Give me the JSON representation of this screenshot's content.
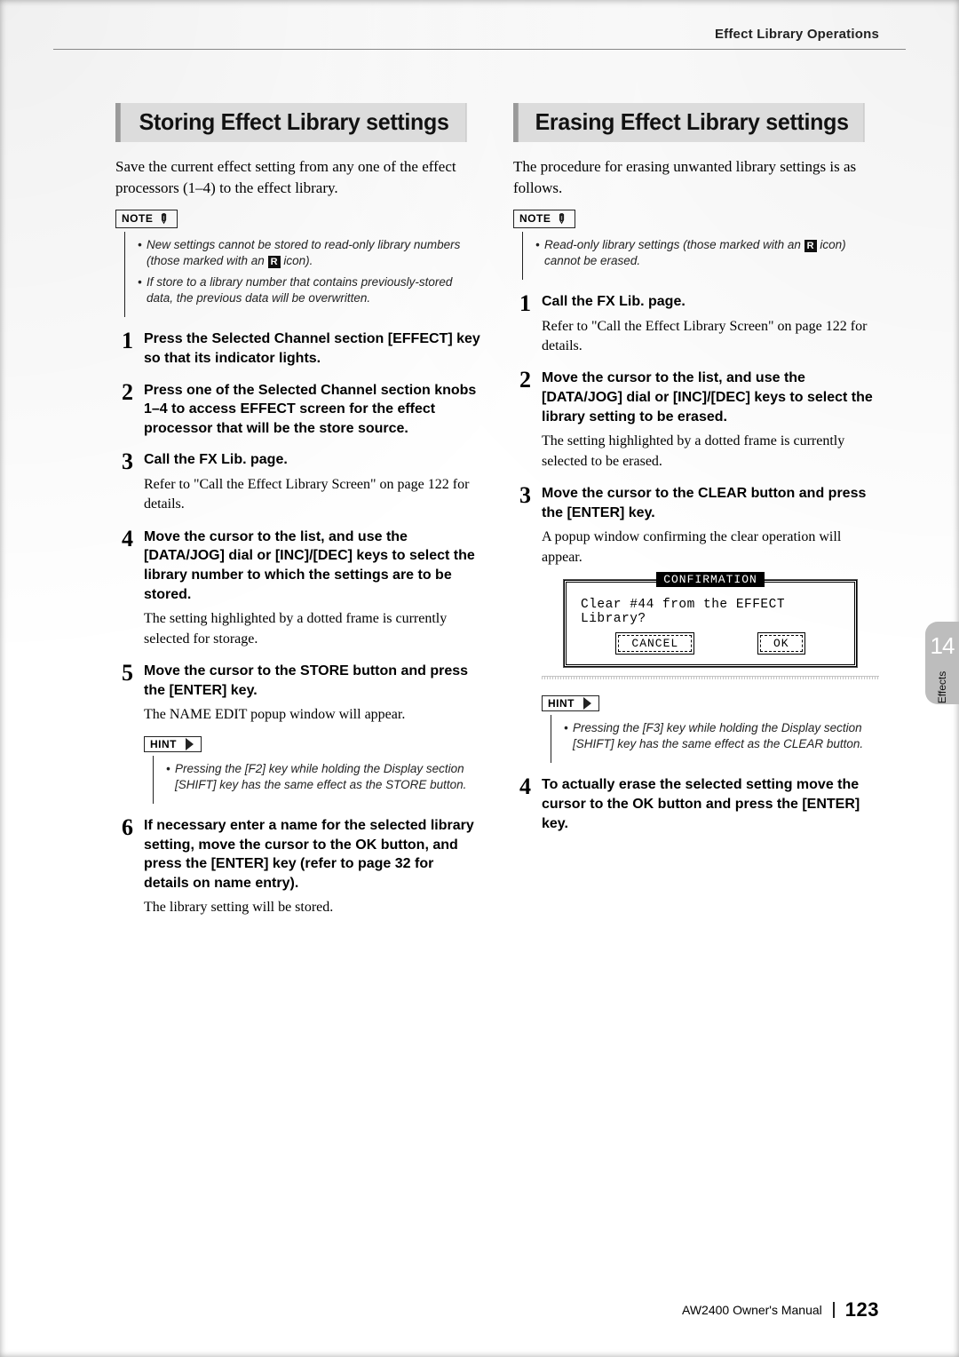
{
  "running_head": "Effect Library Operations",
  "left": {
    "title": "Storing Effect Library settings",
    "intro": "Save the current effect setting from any one of the effect processors (1–4) to the effect library.",
    "note_label": "NOTE",
    "note_items": {
      "a_pre": "New settings cannot be stored to read-only library numbers (those marked with an ",
      "a_post": " icon).",
      "b": "If store to a library number that contains previously-stored data, the previous data will be overwritten."
    },
    "r_icon_text": "R",
    "steps": [
      {
        "num": "1",
        "head": "Press the Selected Channel section [EFFECT] key so that its indicator lights."
      },
      {
        "num": "2",
        "head": "Press one of the Selected Channel section knobs 1–4 to access EFFECT screen for the effect processor that will be the store source."
      },
      {
        "num": "3",
        "head": "Call the FX Lib. page.",
        "text": "Refer to \"Call the Effect Library Screen\" on page 122 for details."
      },
      {
        "num": "4",
        "head": "Move the cursor to the list, and use the [DATA/JOG] dial or [INC]/[DEC] keys to select the library number to which the settings are to be stored.",
        "text": "The setting highlighted by a dotted frame is currently selected for storage."
      },
      {
        "num": "5",
        "head": "Move the cursor to the STORE button and press the [ENTER] key.",
        "text": "The NAME EDIT popup window will appear."
      },
      {
        "num": "6",
        "head": "If necessary enter a name for the selected library setting, move the cursor to the OK button, and press the [ENTER] key (refer to page 32 for details on name entry).",
        "text": "The library setting will be stored."
      }
    ],
    "hint_label": "HINT",
    "hint_text": "Pressing the [F2] key while holding the Display section [SHIFT] key has the same effect as the STORE button."
  },
  "right": {
    "title": "Erasing Effect Library settings",
    "intro": "The procedure for erasing unwanted library settings is as follows.",
    "note_label": "NOTE",
    "note_pre": "Read-only library settings (those marked with an ",
    "note_post": " icon) cannot be erased.",
    "r_icon_text": "R",
    "steps": [
      {
        "num": "1",
        "head": "Call the FX Lib. page.",
        "text": "Refer to \"Call the Effect Library Screen\" on page 122 for details."
      },
      {
        "num": "2",
        "head": "Move the cursor to the list, and use the [DATA/JOG] dial or [INC]/[DEC] keys to select the library setting to be erased.",
        "text": "The setting highlighted by a dotted frame is currently selected to be erased."
      },
      {
        "num": "3",
        "head": "Move the cursor to the CLEAR button and press the [ENTER] key.",
        "text": "A popup window confirming the clear operation will appear."
      },
      {
        "num": "4",
        "head": "To actually erase the selected setting move the cursor to the OK button and press the [ENTER] key."
      }
    ],
    "dialog": {
      "title": "CONFIRMATION",
      "message": "Clear #44 from the EFFECT Library?",
      "cancel": "CANCEL",
      "ok": "OK"
    },
    "hint_label": "HINT",
    "hint_text": "Pressing the [F3] key while holding the Display section [SHIFT] key has the same effect as the CLEAR button."
  },
  "side_tab": {
    "num": "14",
    "label": "Effects"
  },
  "footer": {
    "book": "AW2400  Owner's Manual",
    "page": "123"
  }
}
